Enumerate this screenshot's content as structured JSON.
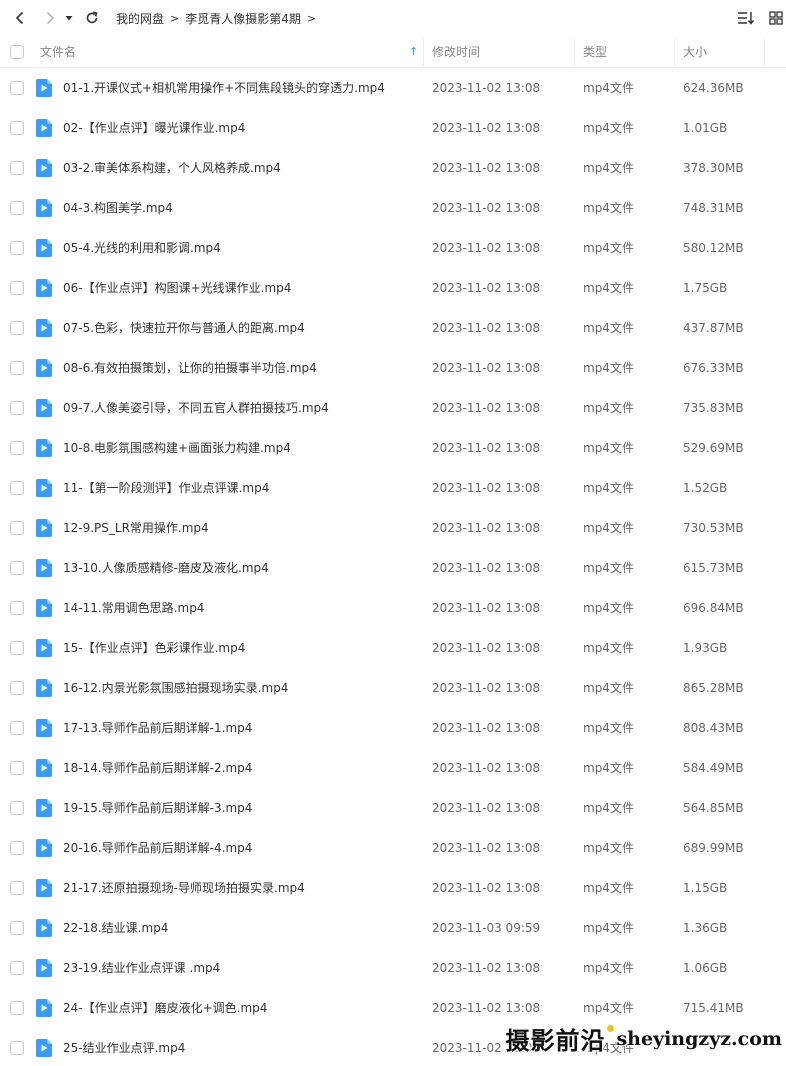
{
  "breadcrumb": [
    "我的网盘",
    "李觅青人像摄影第4期"
  ],
  "columns": {
    "name": "文件名",
    "modified": "修改时间",
    "type": "类型",
    "size": "大小"
  },
  "icons": {
    "back": "chevron-left-icon",
    "forward": "chevron-right-icon",
    "history": "caret-down-icon",
    "refresh": "refresh-icon",
    "sort": "sort-list-icon",
    "view": "grid-view-icon",
    "file": "video-file-icon",
    "sort_dir": "sort-arrow-up-icon"
  },
  "colors": {
    "accent": "#2b8cf0",
    "file_icon": "#3b9bf5"
  },
  "files": [
    {
      "name": "01-1.开课仪式+相机常用操作+不同焦段镜头的穿透力.mp4",
      "modified": "2023-11-02 13:08",
      "type": "mp4文件",
      "size": "624.36MB"
    },
    {
      "name": "02-【作业点评】曝光课作业.mp4",
      "modified": "2023-11-02 13:08",
      "type": "mp4文件",
      "size": "1.01GB"
    },
    {
      "name": "03-2.审美体系构建，个人风格养成.mp4",
      "modified": "2023-11-02 13:08",
      "type": "mp4文件",
      "size": "378.30MB"
    },
    {
      "name": "04-3.构图美学.mp4",
      "modified": "2023-11-02 13:08",
      "type": "mp4文件",
      "size": "748.31MB"
    },
    {
      "name": "05-4.光线的利用和影调.mp4",
      "modified": "2023-11-02 13:08",
      "type": "mp4文件",
      "size": "580.12MB"
    },
    {
      "name": "06-【作业点评】构图课+光线课作业.mp4",
      "modified": "2023-11-02 13:08",
      "type": "mp4文件",
      "size": "1.75GB"
    },
    {
      "name": "07-5.色彩，快速拉开你与普通人的距离.mp4",
      "modified": "2023-11-02 13:08",
      "type": "mp4文件",
      "size": "437.87MB"
    },
    {
      "name": "08-6.有效拍摄策划，让你的拍摄事半功倍.mp4",
      "modified": "2023-11-02 13:08",
      "type": "mp4文件",
      "size": "676.33MB"
    },
    {
      "name": "09-7.人像美姿引导，不同五官人群拍摄技巧.mp4",
      "modified": "2023-11-02 13:08",
      "type": "mp4文件",
      "size": "735.83MB"
    },
    {
      "name": "10-8.电影氛围感构建+画面张力构建.mp4",
      "modified": "2023-11-02 13:08",
      "type": "mp4文件",
      "size": "529.69MB"
    },
    {
      "name": "11-【第一阶段测评】作业点评课.mp4",
      "modified": "2023-11-02 13:08",
      "type": "mp4文件",
      "size": "1.52GB"
    },
    {
      "name": "12-9.PS_LR常用操作.mp4",
      "modified": "2023-11-02 13:08",
      "type": "mp4文件",
      "size": "730.53MB"
    },
    {
      "name": "13-10.人像质感精修-磨皮及液化.mp4",
      "modified": "2023-11-02 13:08",
      "type": "mp4文件",
      "size": "615.73MB"
    },
    {
      "name": "14-11.常用调色思路.mp4",
      "modified": "2023-11-02 13:08",
      "type": "mp4文件",
      "size": "696.84MB"
    },
    {
      "name": "15-【作业点评】色彩课作业.mp4",
      "modified": "2023-11-02 13:08",
      "type": "mp4文件",
      "size": "1.93GB"
    },
    {
      "name": "16-12.内景光影氛围感拍摄现场实录.mp4",
      "modified": "2023-11-02 13:08",
      "type": "mp4文件",
      "size": "865.28MB"
    },
    {
      "name": "17-13.导师作品前后期详解-1.mp4",
      "modified": "2023-11-02 13:08",
      "type": "mp4文件",
      "size": "808.43MB"
    },
    {
      "name": "18-14.导师作品前后期详解-2.mp4",
      "modified": "2023-11-02 13:08",
      "type": "mp4文件",
      "size": "584.49MB"
    },
    {
      "name": "19-15.导师作品前后期详解-3.mp4",
      "modified": "2023-11-02 13:08",
      "type": "mp4文件",
      "size": "564.85MB"
    },
    {
      "name": "20-16.导师作品前后期详解-4.mp4",
      "modified": "2023-11-02 13:08",
      "type": "mp4文件",
      "size": "689.99MB"
    },
    {
      "name": "21-17.还原拍摄现场-导师现场拍摄实录.mp4",
      "modified": "2023-11-02 13:08",
      "type": "mp4文件",
      "size": "1.15GB"
    },
    {
      "name": "22-18.结业课.mp4",
      "modified": "2023-11-03 09:59",
      "type": "mp4文件",
      "size": "1.36GB"
    },
    {
      "name": "23-19.结业作业点评课  .mp4",
      "modified": "2023-11-02 13:08",
      "type": "mp4文件",
      "size": "1.06GB"
    },
    {
      "name": "24-【作业点评】磨皮液化+调色.mp4",
      "modified": "2023-11-02 13:08",
      "type": "mp4文件",
      "size": "715.41MB"
    },
    {
      "name": "25-结业作业点评.mp4",
      "modified": "2023-11-02 13:08",
      "type": "mp4文件",
      "size": ""
    }
  ],
  "watermark": {
    "cn": "摄影前沿",
    "en": "sheyingzyz.com"
  }
}
